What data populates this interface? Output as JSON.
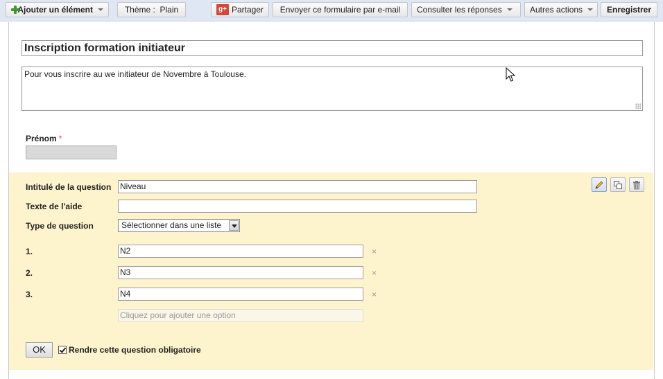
{
  "toolbar": {
    "add_item": "Ajouter un élément",
    "theme": "Thème :  Plain",
    "share": "Partager",
    "email_form": "Envoyer ce formulaire par e-mail",
    "view_responses": "Consulter les réponses",
    "more_actions": "Autres actions",
    "save": "Enregistrer",
    "gplus_glyph": "g+"
  },
  "form": {
    "title": "Inscription formation initiateur",
    "description": "Pour vous inscrire au we initiateur de Novembre à Toulouse.",
    "prenom_label": "Prénom",
    "required_mark": "*"
  },
  "editor": {
    "question_title_label": "Intitulé de la question",
    "question_title_value": "Niveau",
    "help_text_label": "Texte de l'aide",
    "help_text_value": "",
    "question_type_label": "Type de question",
    "question_type_value": "Sélectionner dans une liste",
    "options": [
      {
        "num": "1.",
        "value": "N2",
        "remove": "×"
      },
      {
        "num": "2.",
        "value": "N3",
        "remove": "×"
      },
      {
        "num": "3.",
        "value": "N4",
        "remove": "×"
      }
    ],
    "add_option_placeholder": "Cliquez pour ajouter une option",
    "ok_label": "OK",
    "required_label": "Rendre cette question obligatoire",
    "required_checked": true
  },
  "colors": {
    "toolbar_bg": "#dfe6f4",
    "edit_bg": "#fdf3cc",
    "required_red": "#dd4b39",
    "gplus_red": "#d34836"
  }
}
